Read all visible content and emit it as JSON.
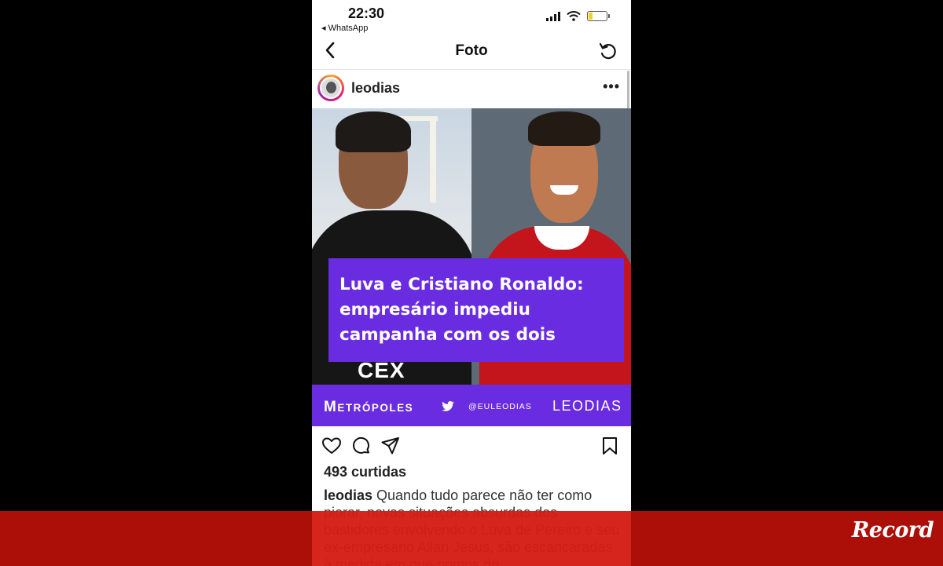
{
  "status_bar": {
    "time": "22:30",
    "back_app": "◂ WhatsApp"
  },
  "nav": {
    "title": "Foto"
  },
  "post": {
    "username": "leodias",
    "more_label": "•••",
    "image": {
      "headline": "Luva e Cristiano Ronaldo: empresário impediu campanha com os dois",
      "shirt_text": "CEX",
      "brand_metropoles_initial": "M",
      "brand_metropoles_rest": "ETRÓPOLES",
      "brand_handle": "@EULEODIAS",
      "brand_leodias": "LEODIAS"
    },
    "likes": "493 curtidas",
    "caption_user": "leodias",
    "caption_text": " Quando tudo parece não ter como piorar, novas situações absurdas dos bastidores envolvendo o Luva de Pereiro e seu ex-empresário Allan Jesus, são escancaradas à medida em que pomos do"
  },
  "overlay": {
    "logo": "Record"
  },
  "colors": {
    "brand_purple": "#6a2ce0",
    "band_red": "#ba1008"
  }
}
